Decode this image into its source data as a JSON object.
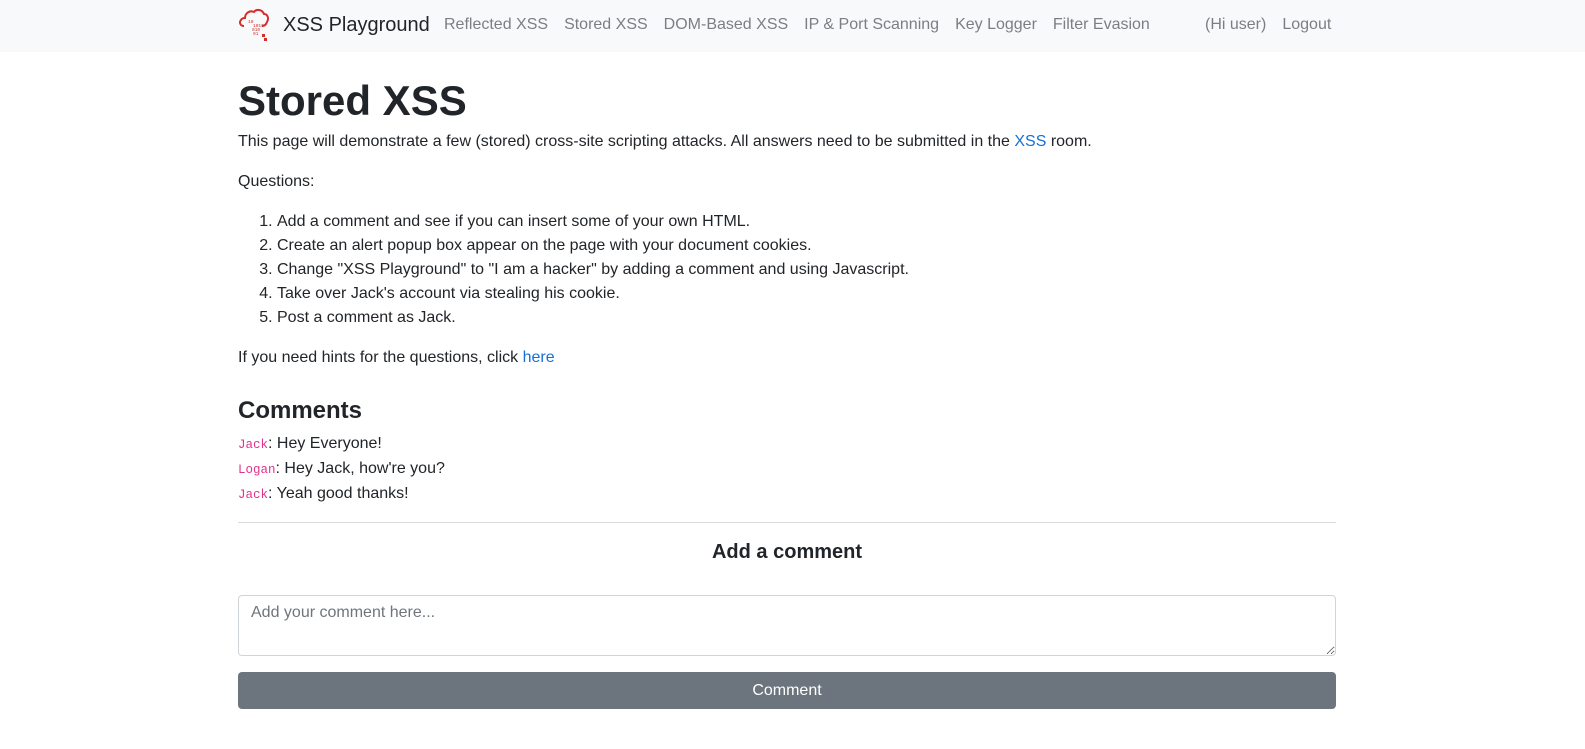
{
  "navbar": {
    "brand": "XSS Playground",
    "links": [
      "Reflected XSS",
      "Stored XSS",
      "DOM-Based XSS",
      "IP & Port Scanning",
      "Key Logger",
      "Filter Evasion"
    ],
    "greeting": "(Hi user)",
    "logout": "Logout"
  },
  "page": {
    "title": "Stored XSS",
    "intro_before": "This page will demonstrate a few (stored) cross-site scripting attacks. All answers need to be submitted in the ",
    "intro_link": "XSS",
    "intro_after": " room.",
    "questions_label": "Questions:",
    "questions": [
      "Add a comment and see if you can insert some of your own HTML.",
      "Create an alert popup box appear on the page with your document cookies.",
      "Change \"XSS Playground\" to \"I am a hacker\" by adding a comment and using Javascript.",
      "Take over Jack's account via stealing his cookie.",
      "Post a comment as Jack."
    ],
    "hints_text": "If you need hints for the questions, click ",
    "hints_link": "here"
  },
  "comments": {
    "heading": "Comments",
    "items": [
      {
        "user": "Jack",
        "text": ": Hey Everyone!"
      },
      {
        "user": "Logan",
        "text": ": Hey Jack, how're you?"
      },
      {
        "user": "Jack",
        "text": ": Yeah good thanks!"
      }
    ]
  },
  "add_comment": {
    "heading": "Add a comment",
    "placeholder": "Add your comment here...",
    "button": "Comment"
  },
  "colors": {
    "link": "#1570d6",
    "username": "#e0338b",
    "button": "#6c757d",
    "navbar_bg": "#f8f9fa"
  }
}
